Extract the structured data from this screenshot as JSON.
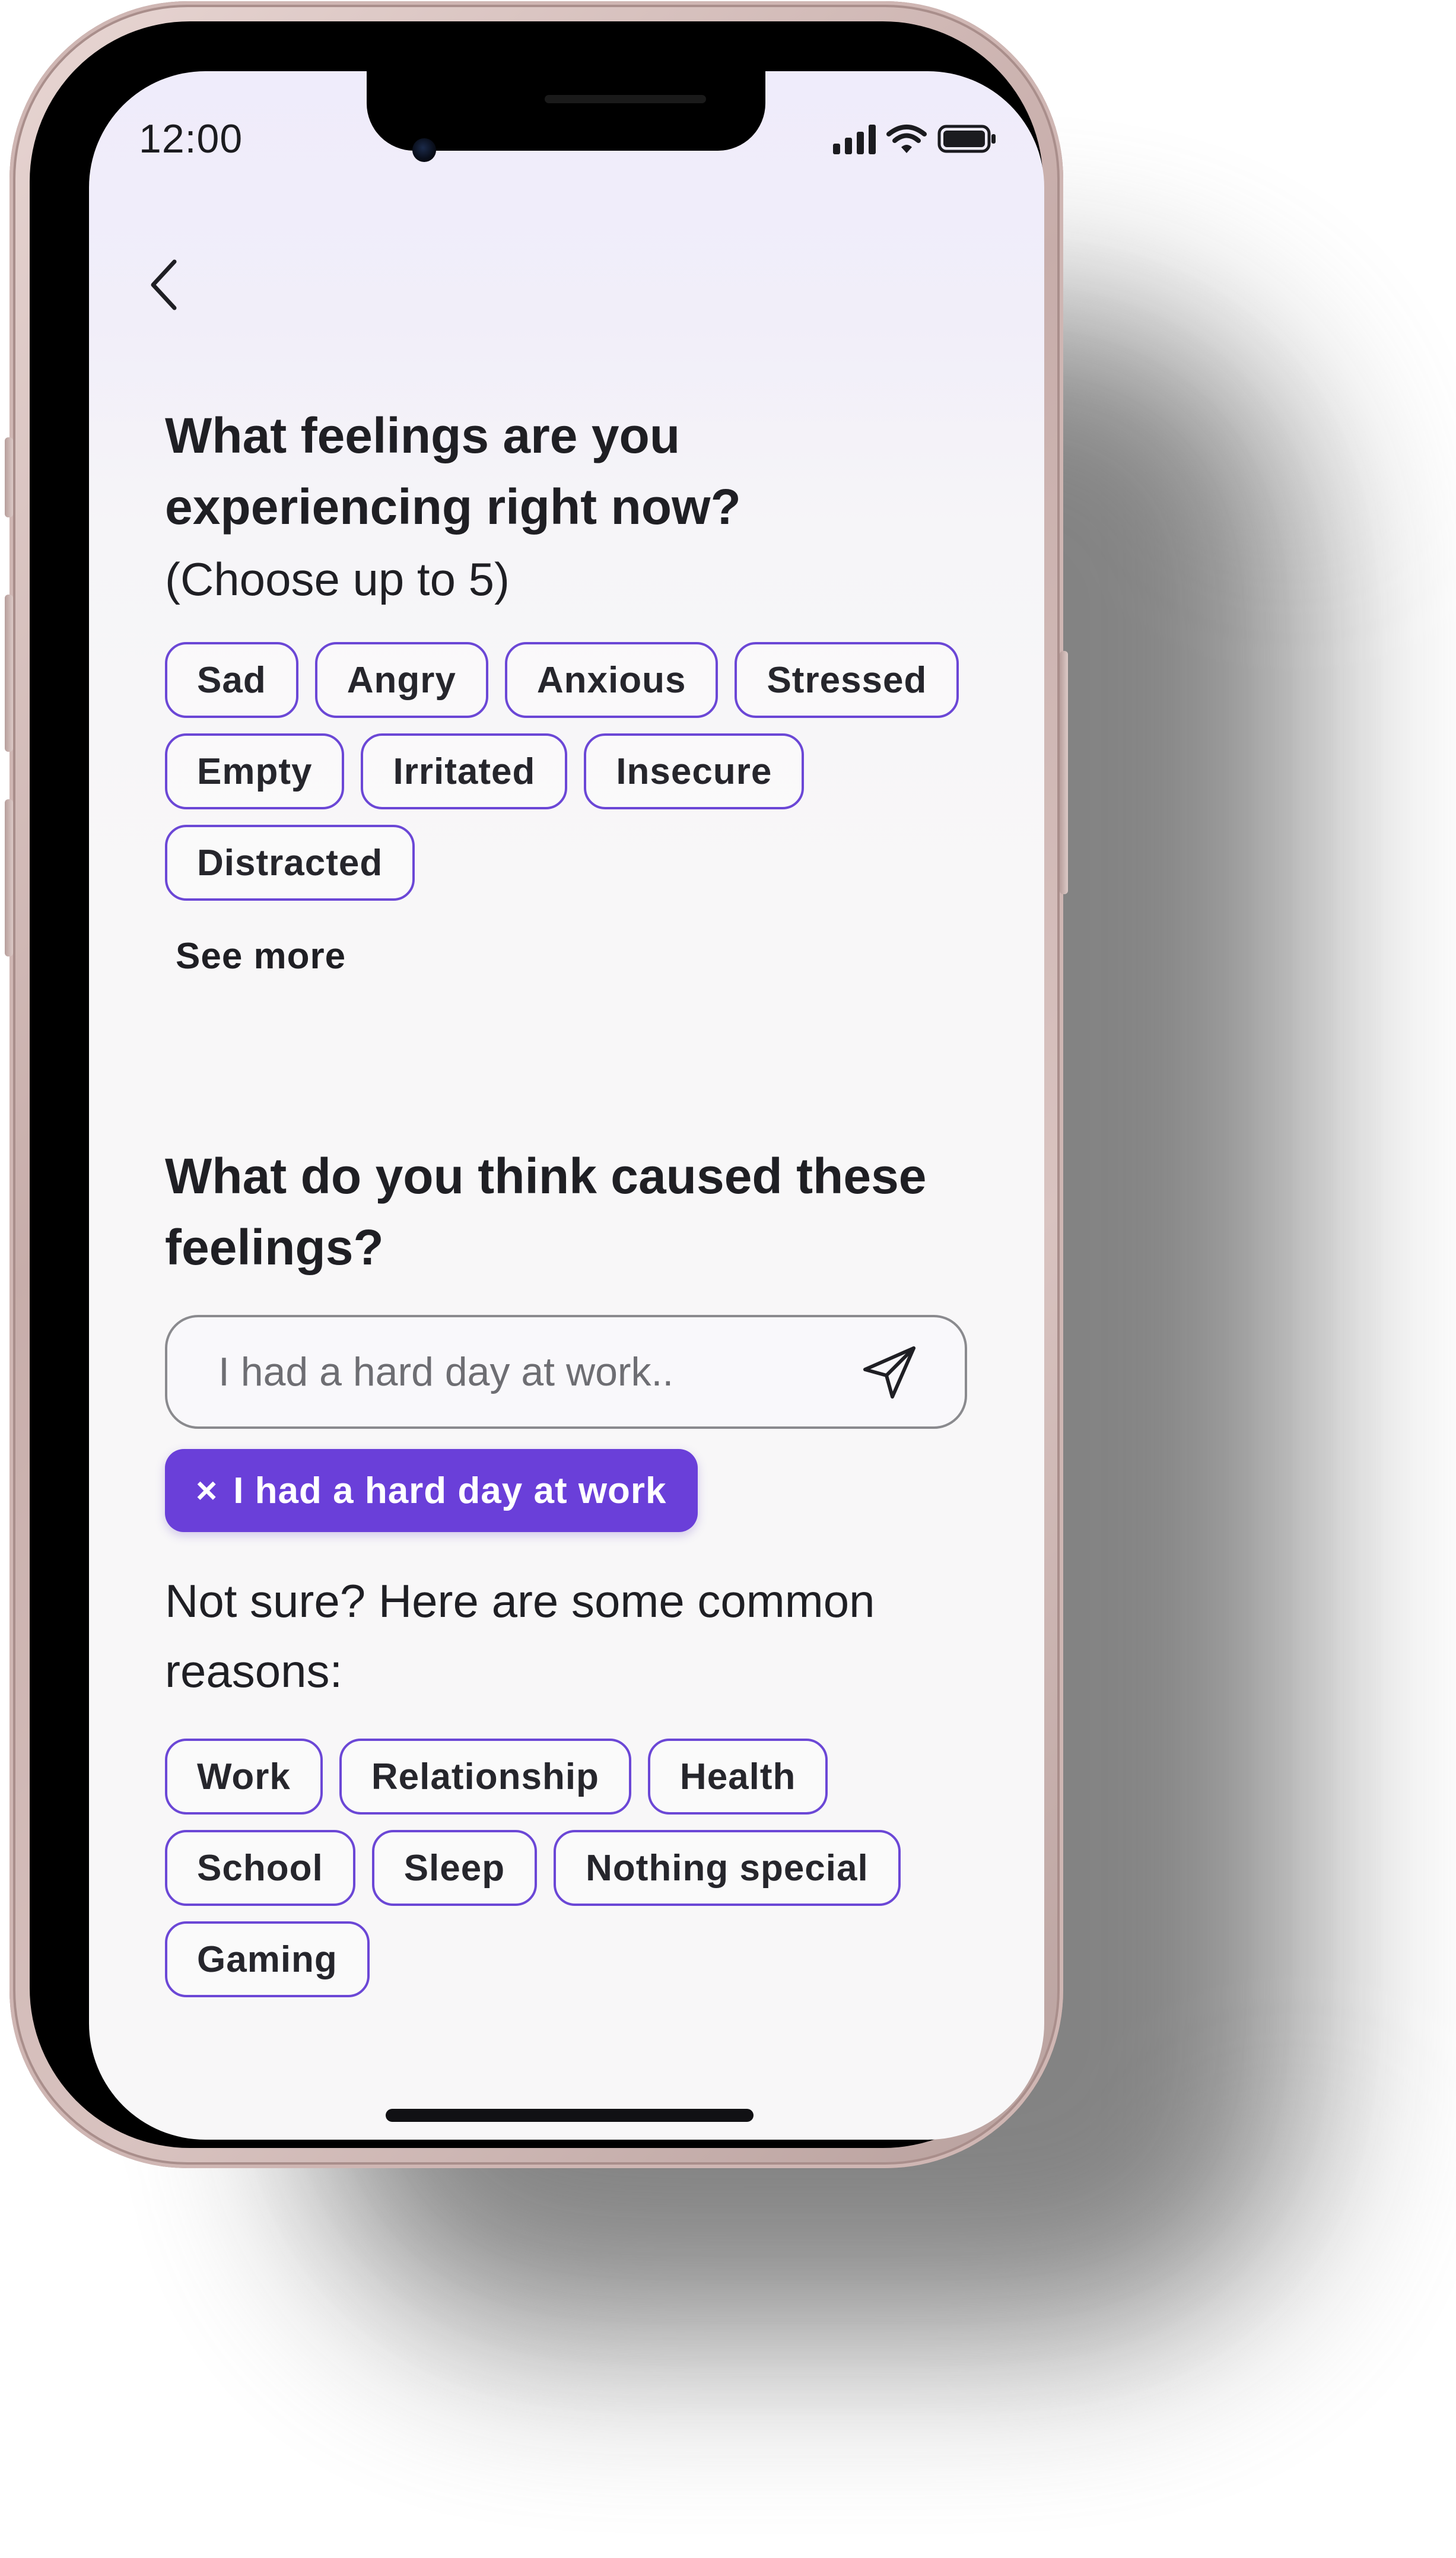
{
  "status_bar": {
    "time": "12:00"
  },
  "feelings": {
    "title_line1": "What feelings are you",
    "title_line2": "experiencing right now?",
    "hint": "(Choose up to 5)",
    "chips": [
      "Sad",
      "Angry",
      "Anxious",
      "Stressed",
      "Empty",
      "Irritated",
      "Insecure",
      "Distracted"
    ],
    "see_more_label": "See more"
  },
  "cause": {
    "title_line1": "What do you think caused these",
    "title_line2": "feelings?",
    "input_placeholder": "I had a hard day at work..",
    "input_value": "",
    "selected_reason": "I had a hard day at work",
    "remove_symbol": "×"
  },
  "common_reasons": {
    "title_line1": "Not sure? Here are some common",
    "title_line2": "reasons:",
    "chips": [
      "Work",
      "Relationship",
      "Health",
      "School",
      "Sleep",
      "Nothing special",
      "Gaming"
    ]
  },
  "colors": {
    "accent": "#6a3fd9",
    "chip_border": "#6b47d6",
    "text": "#1f1f24",
    "background_top": "#efecfb",
    "background": "#f8f7f8"
  },
  "icons": {
    "back": "chevron-left-icon",
    "send": "paper-plane-icon",
    "signal": "cellular-signal-icon",
    "wifi": "wifi-icon",
    "battery": "battery-icon"
  }
}
